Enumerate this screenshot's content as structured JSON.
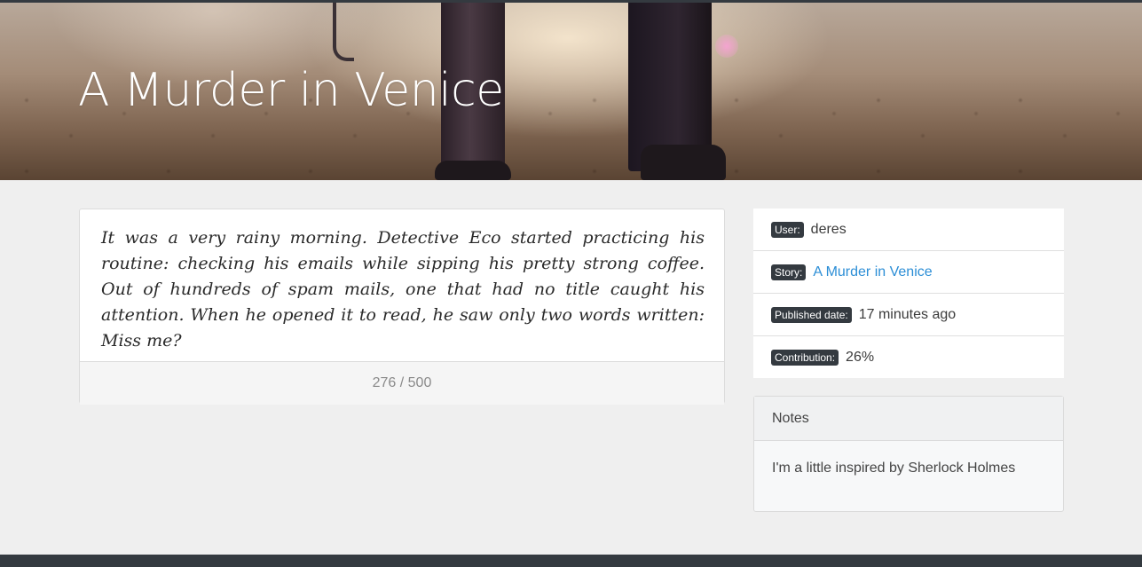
{
  "story": {
    "title": "A Murder in Venice",
    "text": "It was a very rainy morning. Detective Eco started practicing his routine: checking his emails while sipping his pretty strong coffee. Out of hundreds of spam mails, one that had no title caught his attention. When he opened it to read, he saw only two words written: Miss me?",
    "char_count": "276 / 500"
  },
  "meta": {
    "user_label": "User:",
    "user_value": "deres",
    "story_label": "Story:",
    "story_value": "A Murder in Venice",
    "published_label": "Published date:",
    "published_value": "17 minutes ago",
    "contribution_label": "Contribution:",
    "contribution_value": "26%"
  },
  "notes": {
    "header": "Notes",
    "content": "I'm a little inspired by Sherlock Holmes"
  },
  "colors": {
    "badge": "#343a40",
    "link": "#2c8ed6",
    "page_bg": "#efefef"
  }
}
